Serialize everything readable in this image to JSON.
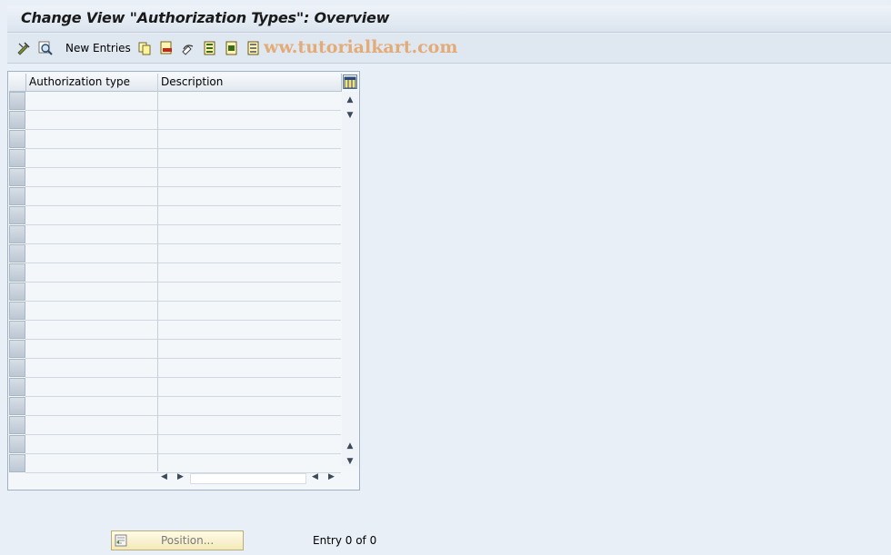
{
  "window": {
    "title": "Change View \"Authorization Types\": Overview"
  },
  "toolbar": {
    "new_entries_label": "New Entries",
    "watermark": "ww.tutorialkart.com",
    "icons": [
      "display-change-icon",
      "details-icon",
      "copy-icon",
      "delete-icon",
      "undo-change-icon",
      "select-all-icon",
      "select-block-icon",
      "deselect-all-icon"
    ]
  },
  "table": {
    "columns": [
      "Authorization type",
      "Description"
    ],
    "row_count": 20,
    "rows": []
  },
  "footer": {
    "position_button_label": "Position...",
    "entry_counter": "Entry 0 of 0"
  }
}
